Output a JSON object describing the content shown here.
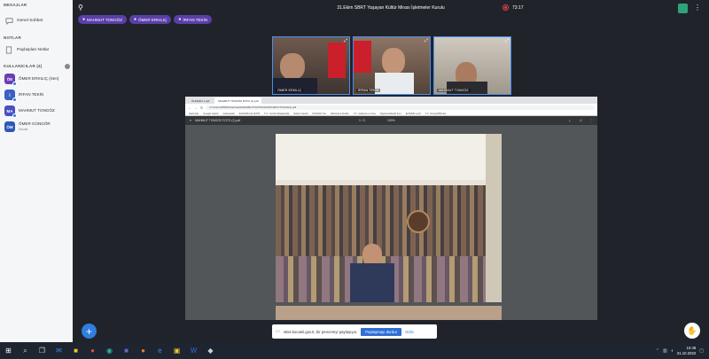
{
  "sidebar": {
    "messages_title": "MESAJLAR",
    "general_chat": "Genel Sohbet",
    "notes_title": "NOTLAR",
    "shared_notes": "Paylaşılan Notlar",
    "users_title": "KULLANICILAR (4)",
    "users": [
      {
        "initials": "ÖE",
        "name": "ÖMER ERKILIÇ (Sen)",
        "sub": "",
        "color": "#6a3fb5"
      },
      {
        "initials": "İ",
        "name": "İRFAN TEKİN",
        "sub": "",
        "color": "#3b5fc4"
      },
      {
        "initials": "MA",
        "name": "MAHMUT TONGÖZ",
        "sub": "",
        "color": "#4b4fc1"
      },
      {
        "initials": "ÖM",
        "name": "ÖMER GÜNGÖR",
        "sub": "Misafir",
        "color": "#2f58b8"
      }
    ]
  },
  "header": {
    "title": "31.Ekim SBRT Yaşayan Kültür Mirası İşletmeler Kurulu",
    "timer": "73:17"
  },
  "speakers": [
    "MAHMUT TONGÖZ",
    "ÖMER ERKILIÇ",
    "İRFAN TEKİN"
  ],
  "cameras": [
    {
      "name": "ÖMER ERKILIÇ"
    },
    {
      "name": "İRFAN TEKİN"
    },
    {
      "name": "MAHMUT TONGÖZ"
    }
  ],
  "browser": {
    "tabs": [
      "ÖLEMAN 1.pdf",
      "MAHMUT TONGÖZ FOTO (1).pdf"
    ],
    "url": "C:/Users/LBSR/Downloads/MAHMUT%20TONGÖZ%20FOTO%20(1).pdf",
    "bookmarks": [
      "Harizade",
      "Google Harita",
      "Çalışmalar",
      "ELİSAB ÇALIŞTIR",
      "T.C. Cumhurbaşkanlığı",
      "Erkan Gazali",
      "RUSANI Sm",
      "Webinar'a Dublu",
      "T.C. Çalışma ve Sos",
      "Sigorta Masraf Fon",
      "ELİSAB 1.pdf",
      "T.C. Sosyal Bilimler"
    ],
    "pdf_title": "MAHMUT TONGÖZ FOTO (1).pdf",
    "page_info": "1 / 3",
    "zoom": "100%"
  },
  "share_bar": {
    "text": "vks4.kocaeli.gov.tr, bir pencereyi paylaşıyor.",
    "stop": "Paylaşmayı durdur",
    "hide": "Gizle"
  },
  "taskbar": {
    "time": "10:49",
    "date": "31.10.2022"
  }
}
